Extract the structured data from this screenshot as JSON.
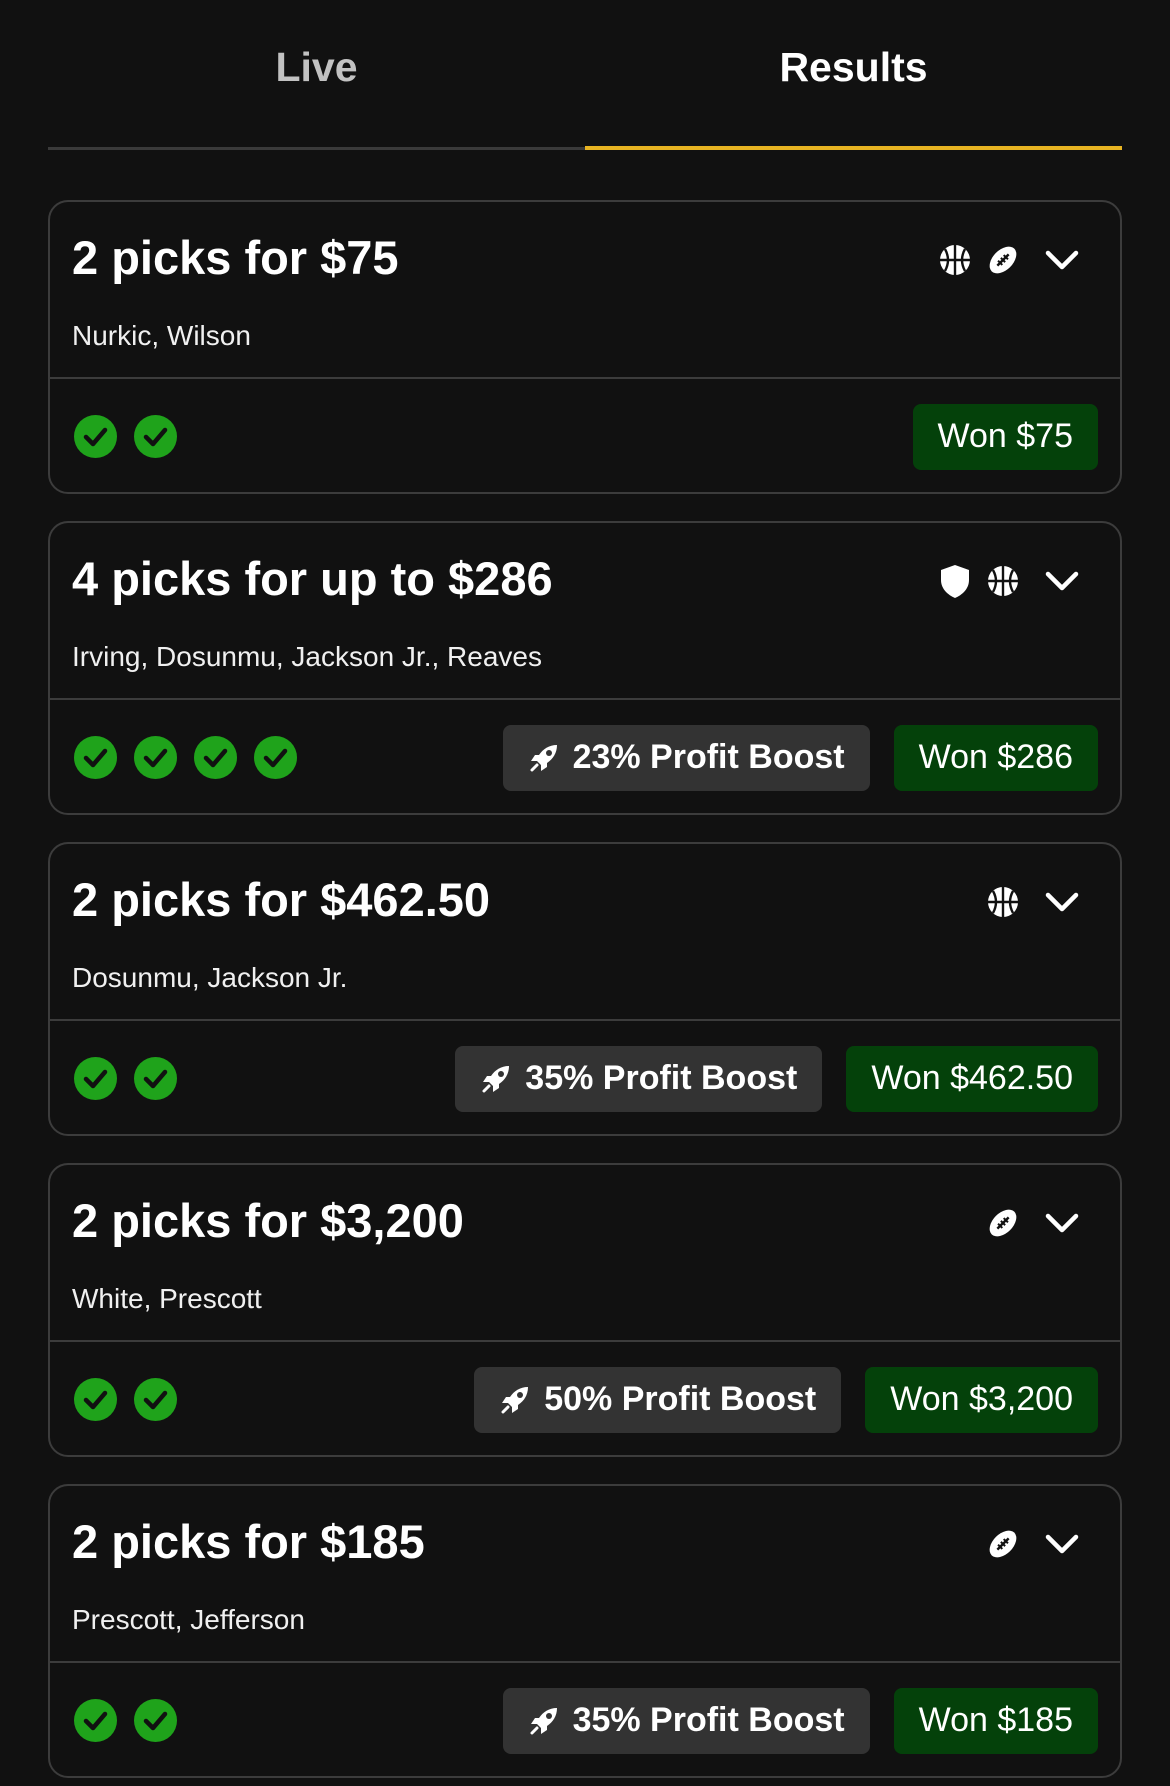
{
  "tabs": {
    "live_label": "Live",
    "results_label": "Results",
    "active": "Results"
  },
  "colors": {
    "background": "#111111",
    "accent_underline": "#e8b422",
    "check_green": "#1fa31b",
    "won_badge": "#04410a",
    "boost_badge": "#333333"
  },
  "cards": [
    {
      "title": "2 picks for $75",
      "players": "Nurkic, Wilson",
      "sport_icons": [
        "basketball-icon",
        "football-icon"
      ],
      "checks": 2,
      "boost": null,
      "won": "Won $75"
    },
    {
      "title": "4 picks for up to $286",
      "players": "Irving, Dosunmu, Jackson Jr., Reaves",
      "sport_icons": [
        "shield-icon",
        "basketball-icon"
      ],
      "checks": 4,
      "boost": "23% Profit Boost",
      "won": "Won $286"
    },
    {
      "title": "2 picks for $462.50",
      "players": "Dosunmu, Jackson Jr.",
      "sport_icons": [
        "basketball-icon"
      ],
      "checks": 2,
      "boost": "35% Profit Boost",
      "won": "Won $462.50"
    },
    {
      "title": "2 picks for $3,200",
      "players": "White, Prescott",
      "sport_icons": [
        "football-icon"
      ],
      "checks": 2,
      "boost": "50% Profit Boost",
      "won": "Won $3,200"
    },
    {
      "title": "2 picks for $185",
      "players": "Prescott, Jefferson",
      "sport_icons": [
        "football-icon"
      ],
      "checks": 2,
      "boost": "35% Profit Boost",
      "won": "Won $185"
    }
  ]
}
